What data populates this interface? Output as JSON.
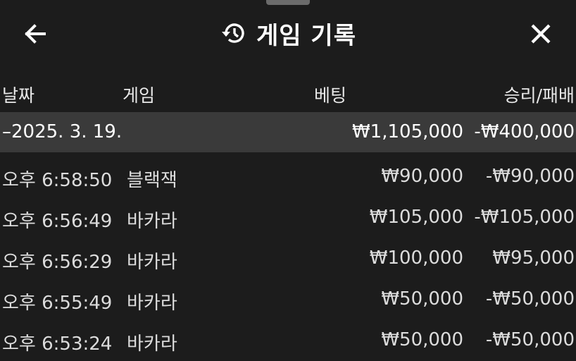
{
  "header": {
    "title": "게임 기록",
    "back_icon": "arrow-left-icon",
    "history_icon": "history-icon",
    "close_icon": "close-icon"
  },
  "columns": {
    "date": "날짜",
    "game": "게임",
    "bet": "베팅",
    "result": "승리/패배"
  },
  "summary": {
    "date": "–2025. 3. 19.",
    "bet": "₩1,105,000",
    "result": "-₩400,000"
  },
  "rows": [
    {
      "time": "오후 6:58:50",
      "game": "블랙잭",
      "bet": "₩90,000",
      "result": "-₩90,000"
    },
    {
      "time": "오후 6:56:49",
      "game": "바카라",
      "bet": "₩105,000",
      "result": "-₩105,000"
    },
    {
      "time": "오후 6:56:29",
      "game": "바카라",
      "bet": "₩100,000",
      "result": "₩95,000"
    },
    {
      "time": "오후 6:55:49",
      "game": "바카라",
      "bet": "₩50,000",
      "result": "-₩50,000"
    },
    {
      "time": "오후 6:53:24",
      "game": "바카라",
      "bet": "₩50,000",
      "result": "-₩50,000"
    }
  ],
  "colors": {
    "background": "#1c1c1c",
    "summary_row": "#3a3a3a",
    "text": "#ffffff",
    "muted_text": "#dcdcdc"
  }
}
